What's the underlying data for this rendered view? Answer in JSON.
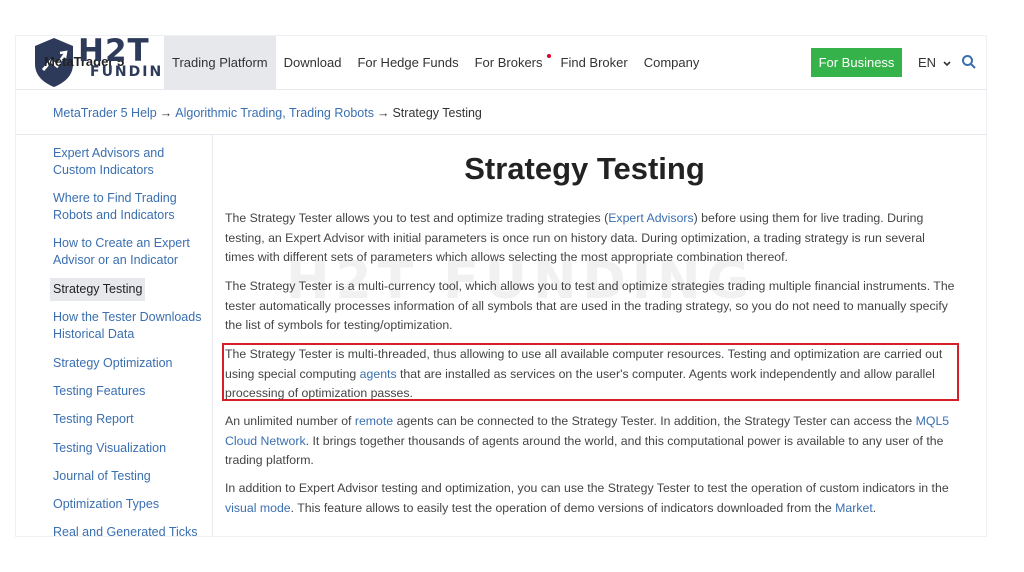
{
  "header": {
    "logo": {
      "mt5": "MetaTrader 5",
      "brand_top": "H2T",
      "brand_bottom": "FUNDING"
    },
    "nav": [
      {
        "label": "Trading Platform",
        "active": true
      },
      {
        "label": "Download",
        "active": false
      },
      {
        "label": "For Hedge Funds",
        "active": false
      },
      {
        "label": "For Brokers",
        "active": false
      },
      {
        "label": "Find Broker",
        "active": false
      },
      {
        "label": "Company",
        "active": false
      }
    ],
    "business_button": "For Business",
    "language": "EN",
    "search_icon": "search-icon",
    "accent_color": "#36b24a"
  },
  "breadcrumb": {
    "items": [
      "MetaTrader 5 Help",
      "Algorithmic Trading, Trading Robots",
      "Strategy Testing"
    ],
    "separator": "→"
  },
  "sidebar": {
    "items": [
      "Expert Advisors and Custom Indicators",
      "Where to Find Trading Robots and Indicators",
      "How to Create an Expert Advisor or an Indicator",
      "Strategy Testing",
      "How the Tester Downloads Historical Data",
      "Strategy Optimization",
      "Testing Features",
      "Testing Report",
      "Testing Visualization",
      "Journal of Testing",
      "Optimization Types",
      "Real and Generated Ticks"
    ],
    "active_index": 3
  },
  "main": {
    "title": "Strategy Testing",
    "watermark": "H2T FUNDING",
    "p1": {
      "a": "The Strategy Tester allows you to test and optimize trading strategies (",
      "link": "Expert Advisors",
      "b": ") before using them for live trading. During testing, an Expert Advisor with initial parameters is once run on history data. During optimization, a trading strategy is run several times with different sets of parameters which allows selecting the most appropriate combination thereof."
    },
    "p2": "The Strategy Tester is a multi-currency tool, which allows you to test and optimize strategies trading multiple financial instruments. The tester automatically processes information of all symbols that are used in the trading strategy, so you do not need to manually specify the list of symbols for testing/optimization.",
    "p3": {
      "a": "The Strategy Tester is multi-threaded, thus allowing to use all available computer resources. Testing and optimization are carried out using special computing ",
      "link": "agents",
      "b": " that are installed as services on the user's computer. Agents work independently and allow parallel processing of optimization passes."
    },
    "p4": {
      "a": "An unlimited number of ",
      "link1": "remote",
      "b": " agents can be connected to the Strategy Tester. In addition, the Strategy Tester can access the ",
      "link2": "MQL5 Cloud Network",
      "c": ". It brings together thousands of agents around the world, and this computational power is available to any user of the trading platform."
    },
    "p5": {
      "a": "In addition to Expert Advisor testing and optimization, you can use the Strategy Tester to test the operation of custom indicators in the ",
      "link1": "visual mode",
      "b": ". This feature allows to easily test the operation of demo versions of indicators downloaded from the ",
      "link2": "Market",
      "c": "."
    },
    "highlight_color": "#d71f2a"
  }
}
